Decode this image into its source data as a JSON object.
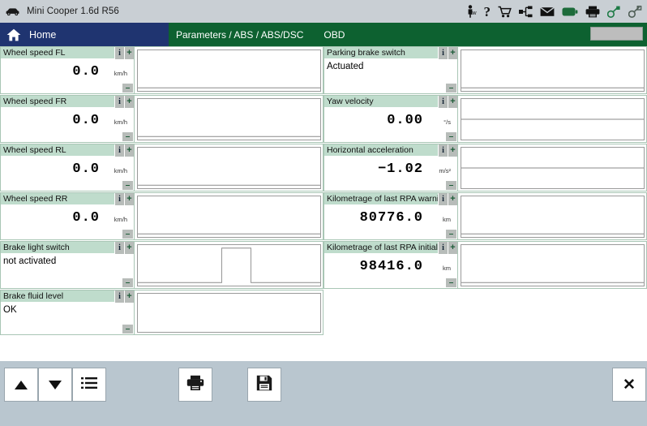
{
  "titlebar": {
    "vehicle": "Mini Cooper 1.6d R56",
    "car_icon": "car-icon",
    "icons": [
      {
        "name": "person-tw-icon",
        "label": "tw"
      },
      {
        "name": "help-question-icon",
        "label": "?"
      },
      {
        "name": "shopping-cart-icon",
        "label": ""
      },
      {
        "name": "network-tree-icon",
        "label": ""
      },
      {
        "name": "mail-envelope-icon",
        "label": ""
      },
      {
        "name": "battery-icon",
        "label": ""
      },
      {
        "name": "printer-icon",
        "label": ""
      },
      {
        "name": "connector-green-icon",
        "label": ""
      },
      {
        "name": "connector-gray-icon",
        "label": ""
      }
    ]
  },
  "navbar": {
    "home_label": "Home",
    "breadcrumb": "Parameters / ABS / ABS/DSC",
    "protocol": "OBD",
    "status_value": ""
  },
  "buttons": {
    "info": "i",
    "plus": "+",
    "minus": "–"
  },
  "colors": {
    "header_green": "#bfdccc",
    "nav_green": "#0d6130",
    "nav_blue": "#1f3470",
    "toolbar_bg": "#b9c6cf",
    "titlebar_bg": "#c9cfd4",
    "trace": "#8a8a8a"
  },
  "parameters_left": [
    {
      "label": "Wheel speed FL",
      "value": "0.0",
      "unit": "km/h",
      "type": "numeric",
      "trace": "flat-low"
    },
    {
      "label": "Wheel speed FR",
      "value": "0.0",
      "unit": "km/h",
      "type": "numeric",
      "trace": "flat-low"
    },
    {
      "label": "Wheel speed RL",
      "value": "0.0",
      "unit": "km/h",
      "type": "numeric",
      "trace": "flat-low"
    },
    {
      "label": "Wheel speed RR",
      "value": "0.0",
      "unit": "km/h",
      "type": "numeric",
      "trace": "flat-low"
    },
    {
      "label": "Brake light switch",
      "value": "not activated",
      "unit": "",
      "type": "text",
      "trace": "pulse"
    },
    {
      "label": "Brake fluid level",
      "value": "OK",
      "unit": "",
      "type": "text",
      "trace": "none"
    }
  ],
  "parameters_right": [
    {
      "label": "Parking brake switch",
      "value": "Actuated",
      "unit": "",
      "type": "text",
      "trace": "flat-low"
    },
    {
      "label": "Yaw velocity",
      "value": "0.00",
      "unit": "°/s",
      "type": "numeric",
      "trace": "flat-mid"
    },
    {
      "label": "Horizontal acceleration",
      "value": "−1.02",
      "unit": "m/s²",
      "type": "numeric",
      "trace": "flat-mid"
    },
    {
      "label": "Kilometrage of last RPA warning",
      "value": "80776.0",
      "unit": "km",
      "type": "numeric",
      "trace": "flat-low"
    },
    {
      "label": "Kilometrage of last RPA initialisation",
      "value": "98416.0",
      "unit": "km",
      "type": "numeric",
      "trace": "flat-low"
    }
  ],
  "bottom_toolbar": [
    {
      "name": "scroll-up-button",
      "icon": "triangle-up-icon",
      "label": ""
    },
    {
      "name": "scroll-down-button",
      "icon": "triangle-down-icon",
      "label": ""
    },
    {
      "name": "list-view-button",
      "icon": "list-icon",
      "label": ""
    },
    {
      "name": "print-button",
      "icon": "printer-icon",
      "label": ""
    },
    {
      "name": "save-button",
      "icon": "floppy-disk-icon",
      "label": ""
    },
    {
      "name": "close-button",
      "icon": "close-x-icon",
      "label": "✕"
    }
  ]
}
